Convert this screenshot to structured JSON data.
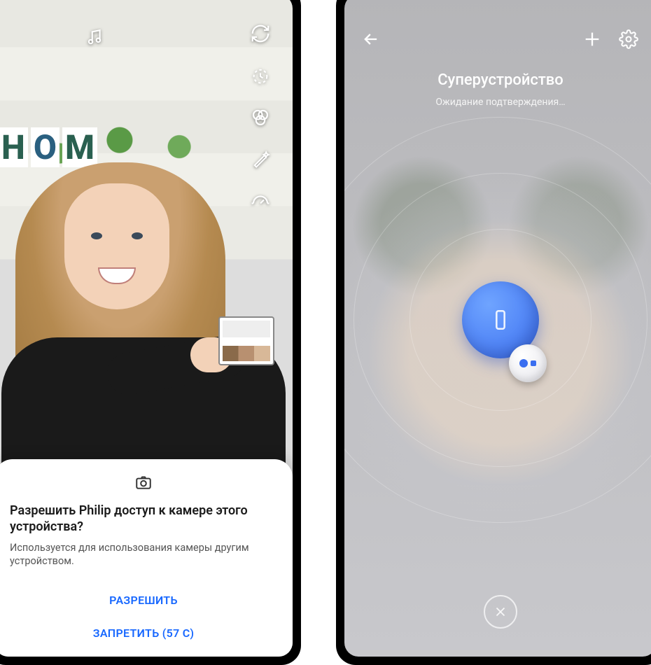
{
  "left": {
    "cameraIcons": {
      "music": "music-icon",
      "swap": "swap-camera-icon",
      "timer": "timer-icon",
      "filters": "filters-icon",
      "wand": "magic-wand-icon",
      "speed": "speed-icon"
    },
    "sheet": {
      "title": "Разрешить Philip доступ к камере этого устройства?",
      "description": "Используется для использования камеры другим устройством.",
      "allow": "РАЗРЕШИТЬ",
      "deny": "ЗАПРЕТИТЬ (57 С)"
    }
  },
  "right": {
    "title": "Суперустройство",
    "subtitle": "Ожидание подтверждения…"
  }
}
